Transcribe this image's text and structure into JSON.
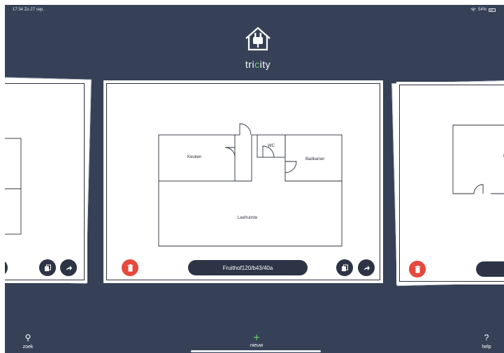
{
  "status": {
    "time": "17:34",
    "date": "Zo 27 sep.",
    "battery": "54%"
  },
  "app": {
    "brand_prefix": "tri",
    "brand_accent": "c",
    "brand_suffix": "ity",
    "accent_color": "#6bd16b",
    "background_color": "#364157",
    "delete_color": "#e5483c"
  },
  "current_plan": {
    "name": "Fruithof120/b43/40a",
    "rooms": {
      "keuken": "Keuken",
      "wc": "WC",
      "badkamer": "Badkamer",
      "leefruimte": "Leefruimte"
    }
  },
  "next_plan": {
    "room_label": "Lu"
  },
  "icons": {
    "delete": "trash-icon",
    "copy": "copy-icon",
    "share": "share-arrow-icon",
    "search": "search-icon",
    "add": "plus-icon",
    "help": "question-icon"
  },
  "tabbar": {
    "search_label": "zoek",
    "new_label": "nieuw",
    "help_label": "help",
    "search_glyph": "⚲",
    "new_glyph": "+",
    "help_glyph": "?"
  }
}
